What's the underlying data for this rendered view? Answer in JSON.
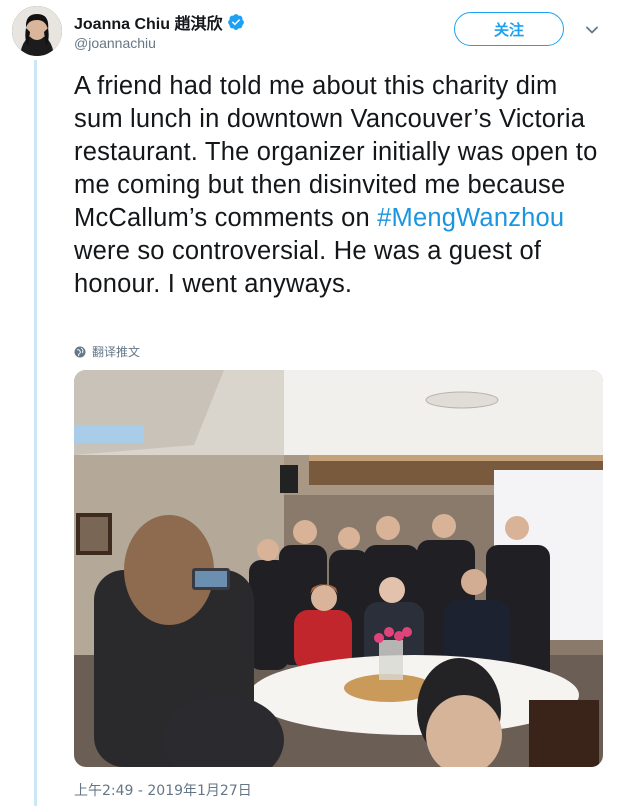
{
  "author": {
    "name": "Joanna Chiu 趙淇欣",
    "handle": "@joannachiu",
    "verified_icon": "verified-badge-icon"
  },
  "header": {
    "follow_label": "关注",
    "more_icon": "chevron-down-icon"
  },
  "tweet": {
    "text_before": "A friend had told me about this charity dim sum lunch in downtown Vancouver’s Victoria restaurant. The organizer initially was open to me coming but then disinvited me because McCallum’s comments on ",
    "hashtag": "#MengWanzhou",
    "text_after": " were so controversial. He was a guest of honour. I went anyways.",
    "translate_label": "翻译推文",
    "timestamp": "上午2:49 - 2019年1月27日"
  },
  "colors": {
    "accent": "#1da1f2",
    "hashtag": "#1b95e0",
    "secondary_text": "#657786",
    "thread_line": "#cce7f8"
  }
}
